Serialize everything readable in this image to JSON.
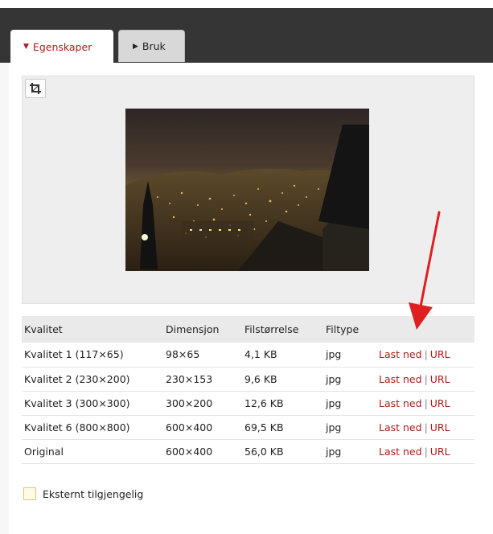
{
  "tabs": [
    {
      "label": "Egenskaper",
      "arrow": "▼"
    },
    {
      "label": "Bruk",
      "arrow": "▶"
    }
  ],
  "preview": {
    "crop_icon": "crop-icon"
  },
  "table": {
    "headers": [
      "Kvalitet",
      "Dimensjon",
      "Filstørrelse",
      "Filtype",
      ""
    ],
    "rows": [
      {
        "quality": "Kvalitet 1 (117×65)",
        "dimension": "98×65",
        "size": "4,1 KB",
        "type": "jpg",
        "download": "Last ned",
        "sep": "|",
        "url": "URL"
      },
      {
        "quality": "Kvalitet 2 (230×200)",
        "dimension": "230×153",
        "size": "9,6 KB",
        "type": "jpg",
        "download": "Last ned",
        "sep": "|",
        "url": "URL"
      },
      {
        "quality": "Kvalitet 3 (300×300)",
        "dimension": "300×200",
        "size": "12,6 KB",
        "type": "jpg",
        "download": "Last ned",
        "sep": "|",
        "url": "URL"
      },
      {
        "quality": "Kvalitet 6 (800×800)",
        "dimension": "600×400",
        "size": "69,5 KB",
        "type": "jpg",
        "download": "Last ned",
        "sep": "|",
        "url": "URL"
      },
      {
        "quality": "Original",
        "dimension": "600×400",
        "size": "56,0 KB",
        "type": "jpg",
        "download": "Last ned",
        "sep": "|",
        "url": "URL"
      }
    ]
  },
  "external": {
    "label": "Eksternt tilgjengelig",
    "checked": false
  },
  "colors": {
    "accent": "#b01a1a",
    "topbar": "#353535",
    "annotation_arrow": "#e02020"
  }
}
